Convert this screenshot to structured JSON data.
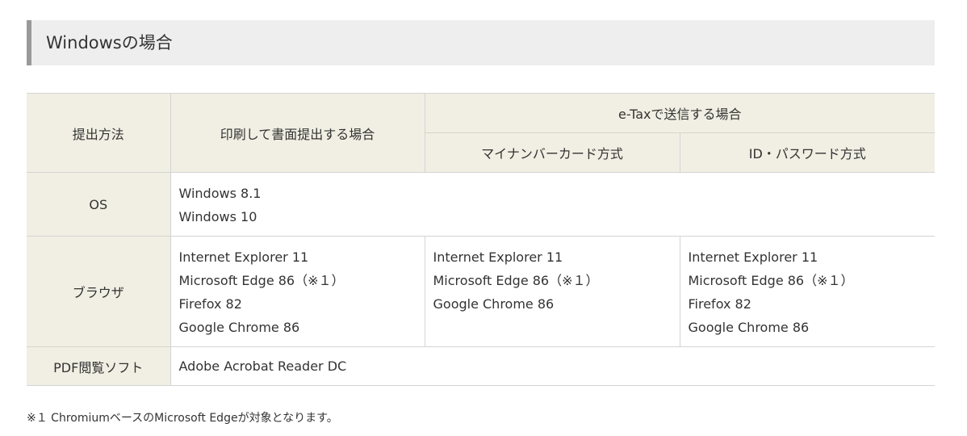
{
  "section": {
    "title": "Windowsの場合"
  },
  "table": {
    "header": {
      "col_method": "提出方法",
      "col_print": "印刷して書面提出する場合",
      "col_etax": "e-Taxで送信する場合",
      "col_mynumber": "マイナンバーカード方式",
      "col_idpw": "ID・パスワード方式"
    },
    "rows": {
      "os": {
        "label": "OS",
        "values": [
          "Windows 8.1",
          "Windows 10"
        ]
      },
      "browser": {
        "label": "ブラウザ",
        "print": [
          "Internet Explorer 11",
          "Microsoft Edge 86（※１）",
          "Firefox 82",
          "Google Chrome 86"
        ],
        "mynumber": [
          "Internet Explorer 11",
          "Microsoft Edge 86（※１）",
          "Google Chrome 86"
        ],
        "idpw": [
          "Internet Explorer 11",
          "Microsoft Edge 86（※１）",
          "Firefox 82",
          "Google Chrome 86"
        ]
      },
      "pdf": {
        "label": "PDF閲覧ソフト",
        "value": "Adobe Acrobat Reader DC"
      }
    }
  },
  "footnote": "※１ ChromiumベースのMicrosoft Edgeが対象となります。"
}
